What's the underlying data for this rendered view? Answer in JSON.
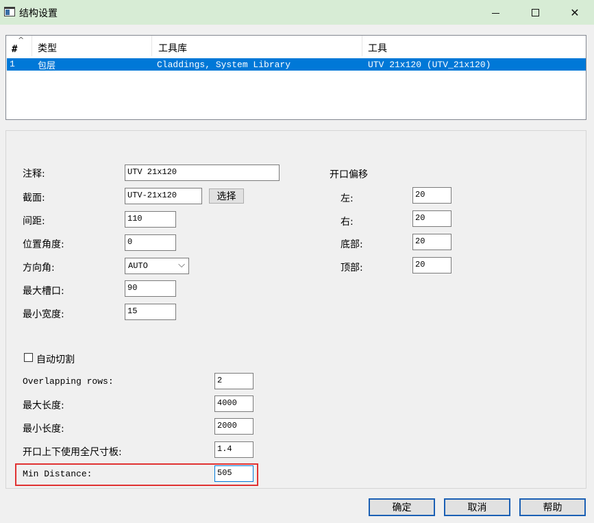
{
  "window": {
    "title": "结构设置",
    "minimize_icon": "minimize-icon",
    "maximize_icon": "maximize-icon",
    "close_icon": "close-icon",
    "close_glyph": "✕"
  },
  "tool_list": {
    "sort_glyph": "^",
    "columns": [
      "#",
      "类型",
      "工具库",
      "工具"
    ],
    "rows": [
      {
        "index": "1",
        "type": "包层",
        "library": "Claddings, System Library",
        "tool": "UTV 21x120 (UTV_21x120)"
      }
    ]
  },
  "settings": {
    "comment_label": "注释:",
    "comment_value": "UTV 21x120",
    "section_label": "截面:",
    "section_value": "UTV-21x120",
    "select_button": "选择",
    "spacing_label": "间距:",
    "spacing_value": "110",
    "position_angle_label": "位置角度:",
    "position_angle_value": "0",
    "direction_angle_label": "方向角:",
    "direction_angle_value": "AUTO",
    "max_slot_label": "最大槽口:",
    "max_slot_value": "90",
    "min_width_label": "最小宽度:",
    "min_width_value": "15"
  },
  "opening_offset": {
    "heading": "开口偏移",
    "left_label": "左:",
    "left_value": "20",
    "right_label": "右:",
    "right_value": "20",
    "bottom_label": "底部:",
    "bottom_value": "20",
    "top_label": "顶部:",
    "top_value": "20"
  },
  "auto_cut": {
    "checkbox_label": "自动切割",
    "checked": false,
    "overlapping_rows_label": "Overlapping rows:",
    "overlapping_rows_value": "2",
    "max_length_label": "最大长度:",
    "max_length_value": "4000",
    "min_length_label": "最小长度:",
    "min_length_value": "2000",
    "full_size_label": "开口上下使用全尺寸板:",
    "full_size_value": "1.4",
    "min_distance_label": "Min Distance:",
    "min_distance_value": "505"
  },
  "buttons": {
    "ok": "确定",
    "cancel": "取消",
    "help": "帮助"
  }
}
